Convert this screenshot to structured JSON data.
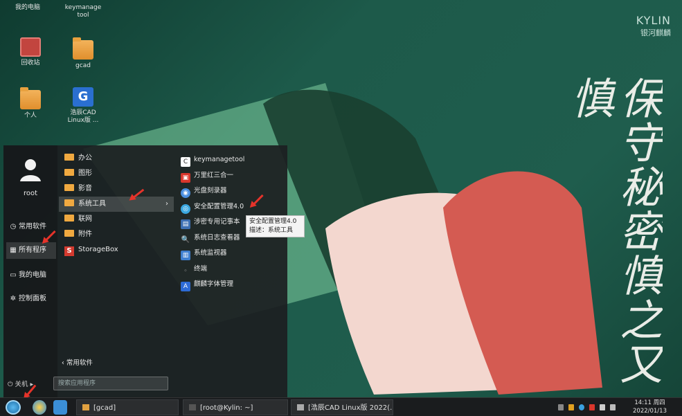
{
  "desktop": {
    "icons": [
      {
        "label": "我的电脑",
        "type": "computer"
      },
      {
        "label": "keymanage tool",
        "type": "app"
      },
      {
        "label": "回收站",
        "type": "trash"
      },
      {
        "label": "gcad",
        "type": "folder"
      },
      {
        "label": "个人",
        "type": "folder"
      },
      {
        "label": "浩辰CAD Linux版 ...",
        "type": "cad"
      }
    ],
    "cad_glyph": "G",
    "logo": {
      "brand": "KYLIN",
      "sub": "银河麒麟"
    },
    "calligraphy": "保守秘密慎之又慎"
  },
  "start_menu": {
    "user": "root",
    "side_items": [
      {
        "label": "常用软件",
        "icon": "clock-icon",
        "glyph": "◷"
      },
      {
        "label": "所有程序",
        "icon": "apps-icon",
        "glyph": "▦"
      },
      {
        "label": "我的电脑",
        "icon": "monitor-icon",
        "glyph": "▭"
      },
      {
        "label": "控制面板",
        "icon": "settings-icon",
        "glyph": "✲"
      }
    ],
    "categories": [
      {
        "label": "办公"
      },
      {
        "label": "图形"
      },
      {
        "label": "影音"
      },
      {
        "label": "系统工具",
        "chevron": "›"
      },
      {
        "label": "联网"
      },
      {
        "label": "附件"
      },
      {
        "label": "StorageBox",
        "glyph": "S"
      }
    ],
    "apps": [
      {
        "label": "keymanagetool",
        "color": "#ffffff",
        "glyph": "C"
      },
      {
        "label": "万里红三合一",
        "color": "#d9362c",
        "glyph": "▣"
      },
      {
        "label": "光盘刻录器",
        "color": "#4a8fe0",
        "glyph": "◉"
      },
      {
        "label": "安全配置管理4.0",
        "color": "#3aa7e0",
        "glyph": "◎"
      },
      {
        "label": "涉密专用记事本",
        "color": "#3d6fb3",
        "glyph": "▤"
      },
      {
        "label": "系统日志查看器",
        "color": "transparent",
        "glyph": "🔍"
      },
      {
        "label": "系统监视器",
        "color": "#3f7fd0",
        "glyph": "▥"
      },
      {
        "label": "终端",
        "color": "transparent",
        "glyph": "◦"
      },
      {
        "label": "麒麟字体管理",
        "color": "#2d6bd6",
        "glyph": "A"
      }
    ],
    "back_label": "‹  常用软件",
    "search_placeholder": "搜索应用程序",
    "power_label": "⏻ 关机 ▸"
  },
  "tooltip": {
    "line1": "安全配置管理4.0",
    "line2": "描述：系统工具"
  },
  "taskbar": {
    "tasks": [
      {
        "label": "[gcad]"
      },
      {
        "label": "[root@Kylin: ~]"
      },
      {
        "label": "[浩辰CAD Linux版 2022(..."
      }
    ],
    "clock_time": "14:11 周四",
    "clock_date": "2022/01/13"
  }
}
